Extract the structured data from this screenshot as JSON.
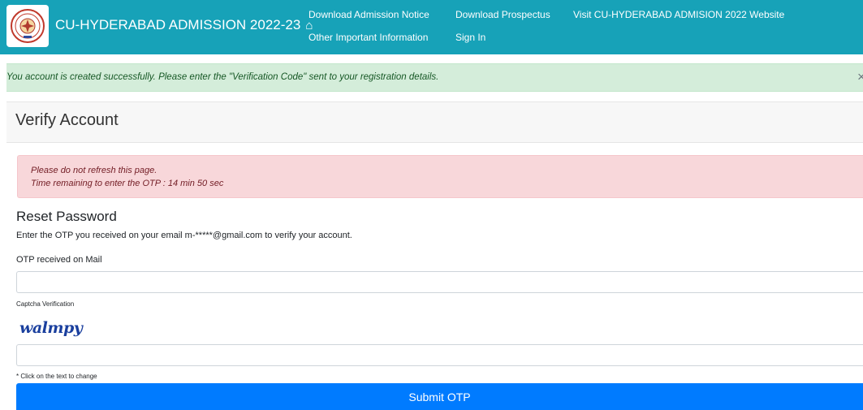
{
  "header": {
    "logo_icon": "university-seal-icon",
    "title": "CU-HYDERABAD ADMISSION 2022-23",
    "home_icon": "home-icon",
    "links": [
      "Download Admission Notice",
      "Download Prospectus",
      "Visit CU-HYDERABAD ADMISION 2022 Website",
      "Other Important Information",
      "Sign In"
    ]
  },
  "success_alert": {
    "message": "You account is created successfully. Please enter the \"Verification Code\" sent to your registration details.",
    "close_label": "×"
  },
  "panel": {
    "title": "Verify Account"
  },
  "warning": {
    "line1": "Please do not refresh this page.",
    "line2": "Time remaining to enter the OTP : 14 min 50 sec"
  },
  "form": {
    "section_title": "Reset Password",
    "instructions": "Enter the OTP you received on your email m-*****@gmail.com to verify your account.",
    "otp_label": "OTP received on Mail",
    "otp_value": "",
    "captcha_label": "Captcha Verification",
    "captcha_text": "walmpy",
    "captcha_value": "",
    "captcha_hint": "* Click on the text to change",
    "submit_label": "Submit OTP"
  },
  "colors": {
    "navbar": "#17a2b8",
    "success_bg": "#d4edda",
    "warning_bg": "#f8d7da",
    "primary": "#007bff"
  }
}
